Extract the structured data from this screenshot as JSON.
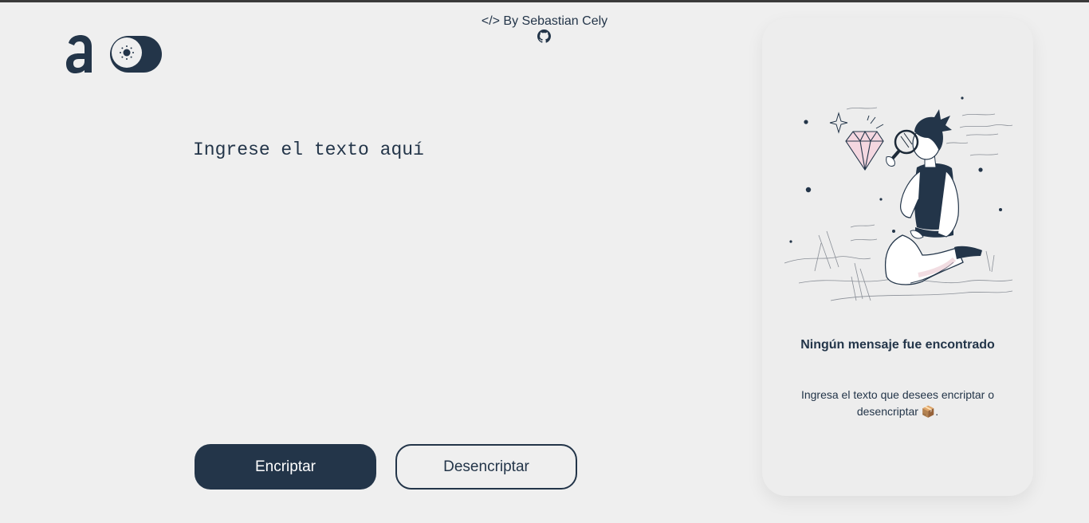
{
  "header": {
    "byline": "</> By Sebastian Cely",
    "logo_icon": "logo-a-icon",
    "theme_toggle_icon": "sun-icon",
    "github_icon": "github-icon"
  },
  "editor": {
    "placeholder": "Ingrese el texto aquí"
  },
  "actions": {
    "encrypt_label": "Encriptar",
    "decrypt_label": "Desencriptar"
  },
  "output_panel": {
    "illustration": "person-with-magnifying-glass-and-diamond",
    "title": "Ningún mensaje fue encontrado",
    "description": "Ingresa el texto que desees encriptar o desencriptar 📦."
  },
  "colors": {
    "primary": "#233549",
    "background": "#efefef"
  }
}
